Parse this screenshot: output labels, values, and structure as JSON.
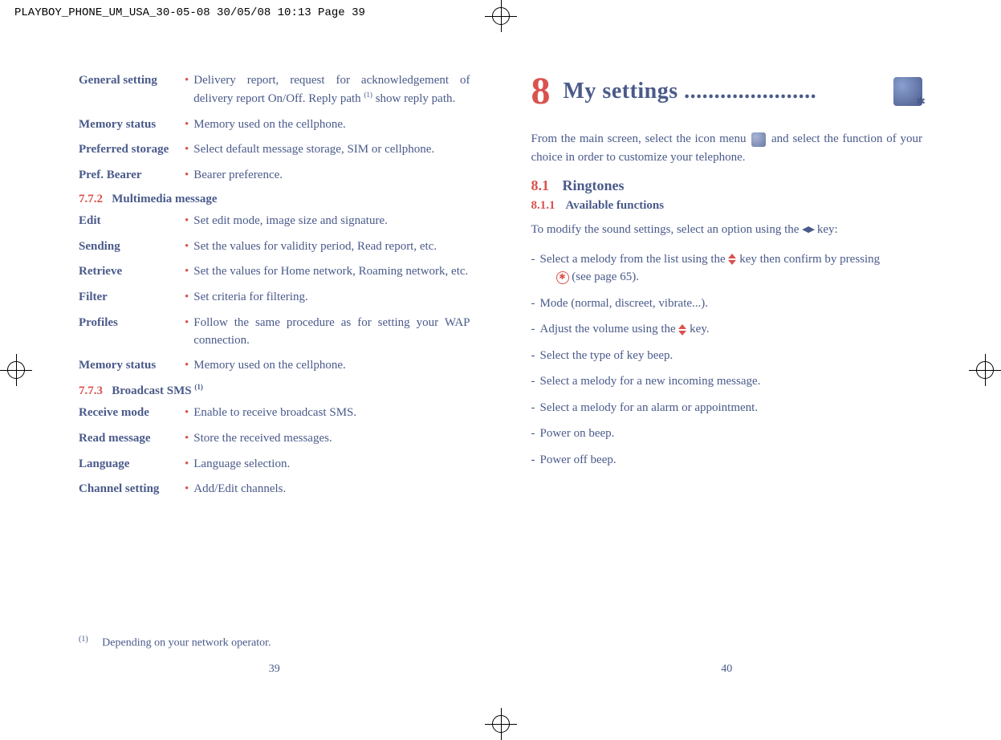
{
  "header": "PLAYBOY_PHONE_UM_USA_30-05-08  30/05/08  10:13  Page 39",
  "left_page": {
    "rows1": [
      {
        "label": "General setting",
        "text": "Delivery report, request for acknowledgement of delivery report On/Off. Reply path (1) show reply path."
      },
      {
        "label": "Memory status",
        "text": "Memory used on the cellphone."
      },
      {
        "label": "Preferred storage",
        "text": "Select default message storage, SIM or cellphone."
      },
      {
        "label": "Pref. Bearer",
        "text": "Bearer preference."
      }
    ],
    "section2": {
      "num": "7.7.2",
      "title": "Multimedia message"
    },
    "rows2": [
      {
        "label": "Edit",
        "text": "Set edit mode, image size and signature."
      },
      {
        "label": "Sending",
        "text": "Set the values for validity period, Read report, etc."
      },
      {
        "label": "Retrieve",
        "text": "Set the values for Home network, Roaming network, etc."
      },
      {
        "label": "Filter",
        "text": "Set criteria for filtering."
      },
      {
        "label": "Profiles",
        "text": "Follow the same procedure as for setting your WAP connection."
      },
      {
        "label": "Memory status",
        "text": "Memory used on the cellphone."
      }
    ],
    "section3": {
      "num": "7.7.3",
      "title": "Broadcast SMS (1)"
    },
    "rows3": [
      {
        "label": "Receive mode",
        "text": "Enable to receive broadcast SMS."
      },
      {
        "label": "Read message",
        "text": "Store the received messages."
      },
      {
        "label": "Language",
        "text": "Language selection."
      },
      {
        "label": "Channel setting",
        "text": "Add/Edit channels."
      }
    ],
    "footnote_marker": "(1)",
    "footnote": "Depending on your network operator.",
    "page_num": "39"
  },
  "right_page": {
    "chapter_num": "8",
    "chapter_title": "My settings ......................",
    "intro_before": "From the main screen, select the icon menu ",
    "intro_after": " and select the function of your choice in order to customize your telephone.",
    "sec81_num": "8.1",
    "sec81_title": "Ringtones",
    "sec811_num": "8.1.1",
    "sec811_title": "Available functions",
    "modify_text_before": "To modify the sound settings, select an option using the ",
    "modify_text_after": " key:",
    "item1_before": "Select a melody from the list using the ",
    "item1_mid": " key then confirm by pressing ",
    "item1_after": " (see page 65).",
    "items": [
      "Mode (normal, discreet, vibrate...).",
      "Adjust the volume using the ",
      "Select the type of key beep.",
      "Select a melody for a new incoming message.",
      "Select a melody for an alarm or appointment.",
      "Power on beep.",
      "Power off beep."
    ],
    "item_volume_after": " key.",
    "page_num": "40"
  }
}
